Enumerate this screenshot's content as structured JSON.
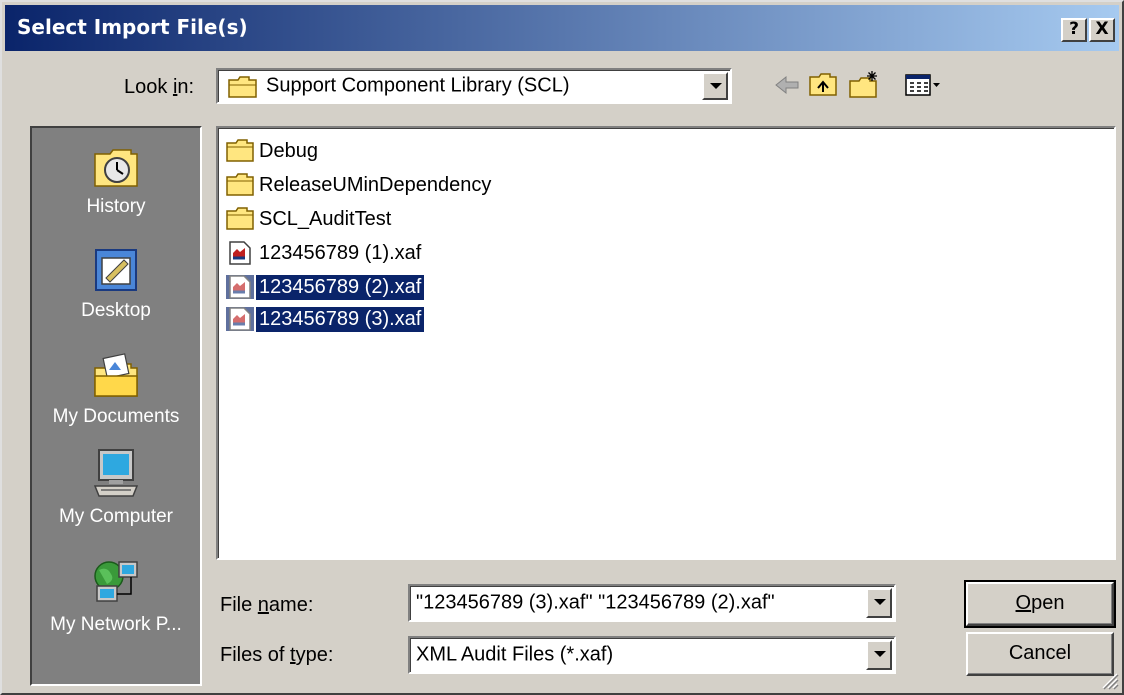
{
  "window": {
    "title": "Select Import File(s)",
    "help_button": "?",
    "close_button": "X"
  },
  "lookin": {
    "label_pre": "Look ",
    "label_u": "i",
    "label_post": "n:",
    "value": "Support Component Library (SCL)"
  },
  "toolbar": {
    "icons": [
      "back-icon",
      "up-folder-icon",
      "new-folder-icon",
      "view-menu-icon"
    ]
  },
  "places": [
    {
      "label": "History",
      "icon": "history-icon"
    },
    {
      "label": "Desktop",
      "icon": "desktop-icon"
    },
    {
      "label": "My Documents",
      "icon": "my-documents-icon"
    },
    {
      "label": "My Computer",
      "icon": "my-computer-icon"
    },
    {
      "label": "My Network P...",
      "icon": "my-network-places-icon"
    }
  ],
  "files": [
    {
      "name": "Debug",
      "type": "folder",
      "selected": false
    },
    {
      "name": "ReleaseUMinDependency",
      "type": "folder",
      "selected": false
    },
    {
      "name": "SCL_AuditTest",
      "type": "folder",
      "selected": false
    },
    {
      "name": "123456789 (1).xaf",
      "type": "xaf",
      "selected": false
    },
    {
      "name": "123456789 (2).xaf",
      "type": "xaf",
      "selected": true
    },
    {
      "name": "123456789 (3).xaf",
      "type": "xaf",
      "selected": true
    }
  ],
  "filename": {
    "label_pre": "File ",
    "label_u": "n",
    "label_post": "ame:",
    "value": "\"123456789 (3).xaf\" \"123456789 (2).xaf\""
  },
  "filetype": {
    "label_pre": "Files of ",
    "label_u": "t",
    "label_post": "ype:",
    "value": "XML Audit Files (*.xaf)"
  },
  "buttons": {
    "open_u": "O",
    "open_rest": "pen",
    "cancel": "Cancel"
  },
  "colors": {
    "title_start": "#0a246a",
    "title_end": "#a6caf0",
    "selection": "#0a246a",
    "face": "#d4d0c8"
  }
}
